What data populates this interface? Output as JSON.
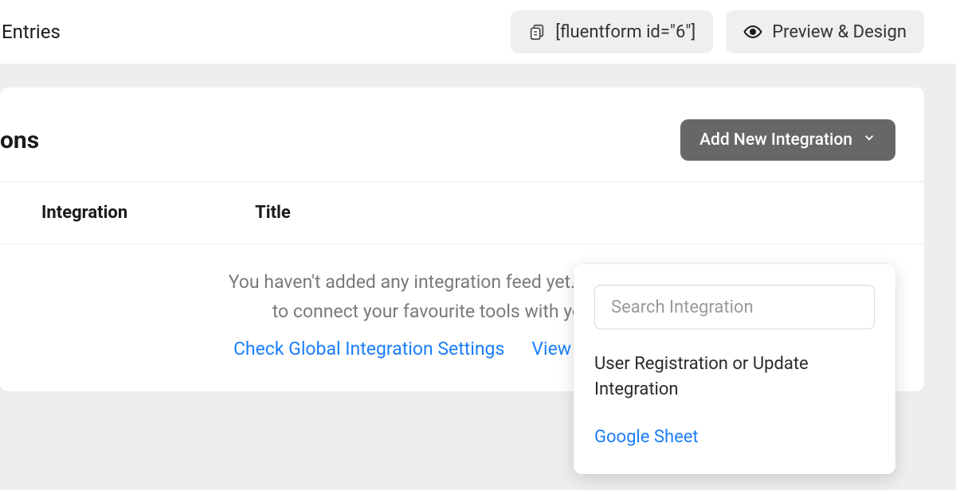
{
  "topbar": {
    "left_tab": "Entries",
    "shortcode": "[fluentform id=\"6\"]",
    "preview": "Preview & Design"
  },
  "card": {
    "title_fragment": "ons",
    "add_button": "Add New Integration",
    "col_integration": "Integration",
    "col_title": "Title",
    "empty_line1": "You haven't added any integration feed yet. Add new integ",
    "empty_line2": "to connect your favourite tools with your forms",
    "link_settings": "Check Global Integration Settings",
    "link_docs": "View Documentatio"
  },
  "popover": {
    "search_placeholder": "Search Integration",
    "item_user_registration": "User Registration or Update Integration",
    "item_google_sheet": "Google Sheet"
  }
}
